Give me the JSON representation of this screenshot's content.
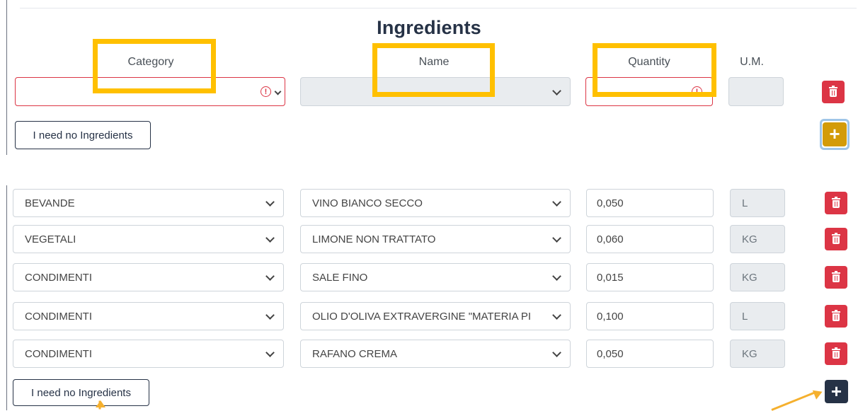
{
  "top_panel": {
    "title": "Ingredients",
    "headers": {
      "category": "Category",
      "name": "Name",
      "quantity": "Quantity",
      "um": "U.M."
    },
    "row": {
      "category": "",
      "name": "",
      "quantity": "",
      "um": ""
    },
    "no_ingredients_label": "I need no Ingredients",
    "add_label": "+",
    "error_glyph": "!"
  },
  "bottom_panel": {
    "rows": [
      {
        "category": "BEVANDE",
        "name": "VINO BIANCO SECCO",
        "quantity": "0,050",
        "um": "L"
      },
      {
        "category": "VEGETALI",
        "name": "LIMONE NON TRATTATO",
        "quantity": "0,060",
        "um": "KG"
      },
      {
        "category": "CONDIMENTI",
        "name": "SALE FINO",
        "quantity": "0,015",
        "um": "KG"
      },
      {
        "category": "CONDIMENTI",
        "name": "OLIO D'OLIVA EXTRAVERGINE \"MATERIA PI",
        "quantity": "0,100",
        "um": "L"
      },
      {
        "category": "CONDIMENTI",
        "name": "RAFANO CREMA",
        "quantity": "0,050",
        "um": "KG"
      }
    ],
    "no_ingredients_label": "I need no Ingredients",
    "add_label": "+"
  },
  "colors": {
    "highlight": "#ffc000",
    "danger": "#dc3545",
    "add_active": "#d39b09",
    "add_dark": "#263246",
    "arrow": "#f5b02e"
  },
  "icons": {
    "delete": "trash-icon",
    "add": "plus-icon",
    "dropdown": "chevron-down-icon",
    "error": "error-circle-icon"
  }
}
